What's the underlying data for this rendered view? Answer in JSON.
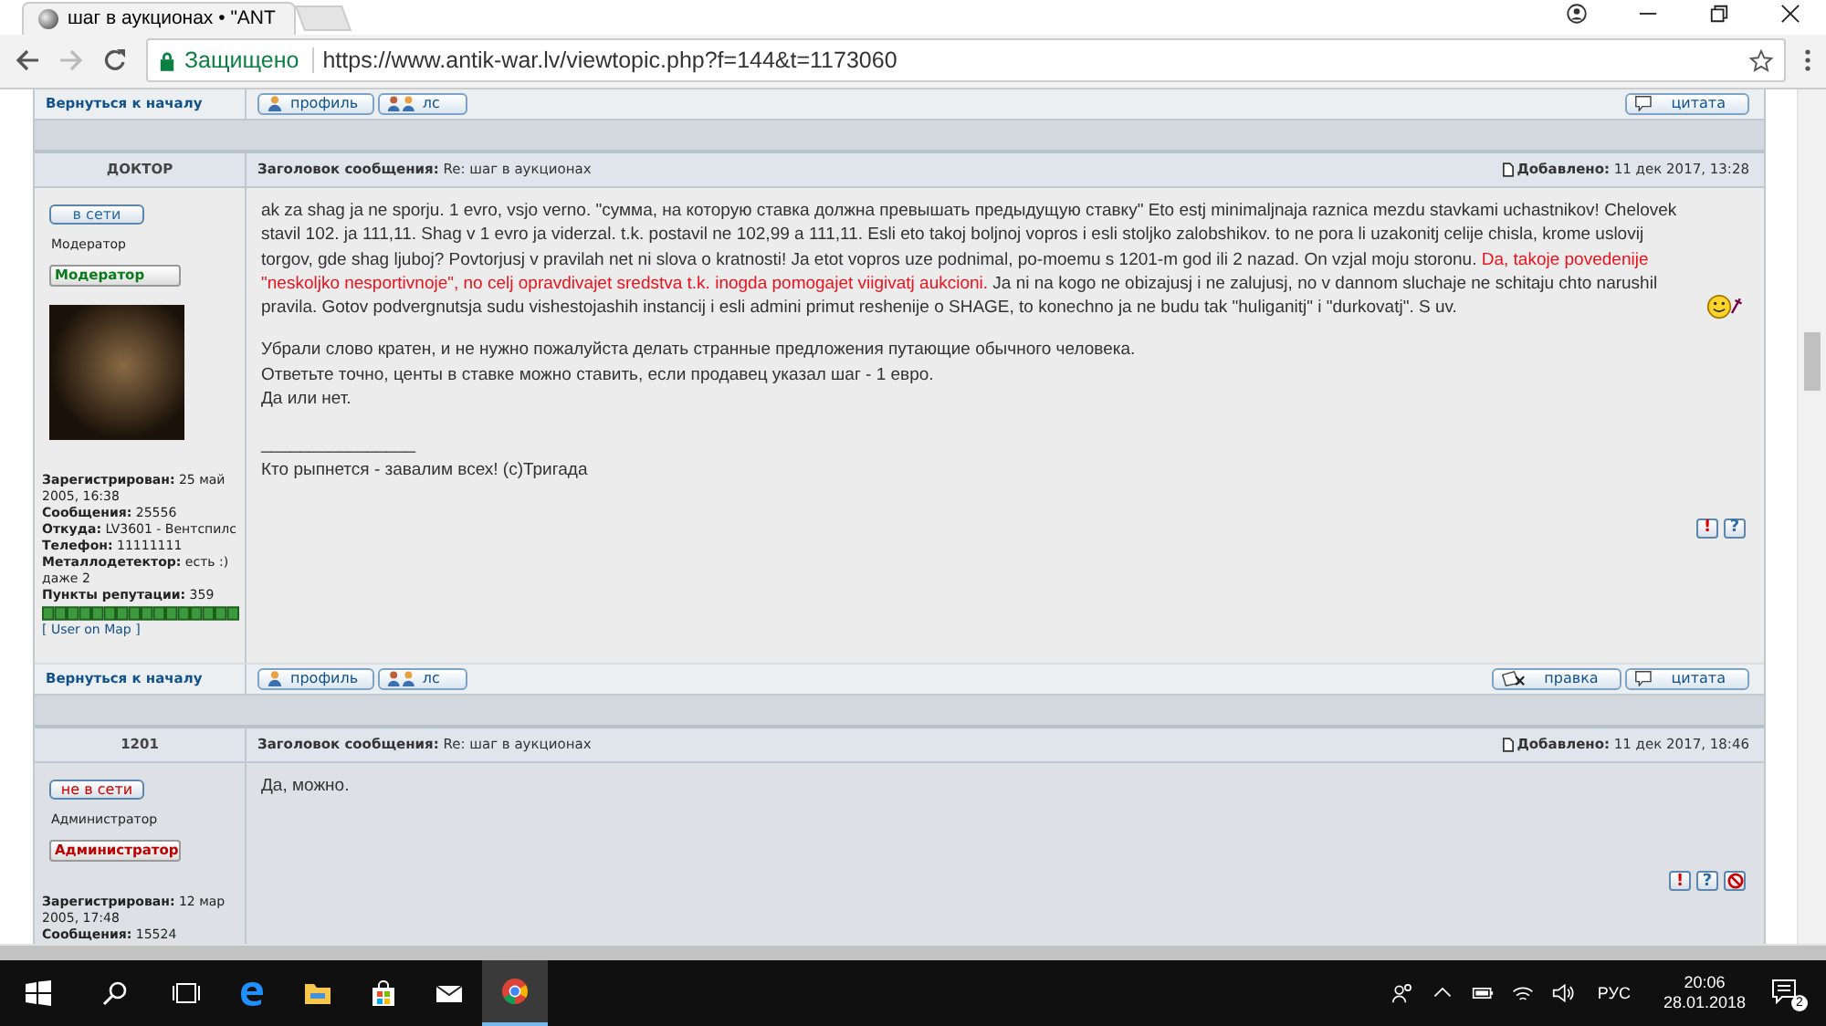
{
  "browser": {
    "tab_title": "шаг в аукционах • \"ANT",
    "secure_label": "Защищено",
    "url": "https://www.antik-war.lv/viewtopic.php?f=144&t=1173060"
  },
  "top_footer": {
    "back_link": "Вернуться к началу",
    "buttons": [
      {
        "kind": "profile",
        "label": "профиль"
      },
      {
        "kind": "pm",
        "label": "лс"
      }
    ],
    "right_buttons": [
      {
        "kind": "quote",
        "label": "цитата"
      }
    ]
  },
  "posts": [
    {
      "author": "ДОКТОР",
      "subject_label": "Заголовок сообщения:",
      "subject": "Re: шаг в аукционах",
      "added_label": "Добавлено:",
      "added": "11 дек 2017, 13:28",
      "online": true,
      "status_label": "в сети",
      "rank": "Модератор",
      "badge": {
        "kind": "moderator",
        "label": "Модератор"
      },
      "avatar": true,
      "details": [
        {
          "label": "Зарегистрирован:",
          "value": "25 май 2005, 16:38"
        },
        {
          "label": "Сообщения:",
          "value": "25556"
        },
        {
          "label": "Откуда:",
          "value": "LV3601 - Вентспилс"
        },
        {
          "label": "Телефон:",
          "value": "11111111"
        },
        {
          "label": "Металлодетектор:",
          "value": "есть :) даже 2"
        },
        {
          "label": "Пункты репутации:",
          "value": "359"
        }
      ],
      "reputation_bar": true,
      "map_link": "[ User on Map ]",
      "segments": [
        {
          "kind": "plain",
          "text": "ak za shag ja ne sporju. 1 evro, vsjo verno. \"сумма, на которую ставка должна превышать предыдущую ставку\" Eto estj minimaljnaja raznica mezdu stavkami uchastnikov! Chelovek stavil 102. ja 111,11. Shag v 1 evro ja viderzal. t.k. postavil ne 102,99 a 111,11. Esli eto takoj boljnoj vopros i esli stoljko zalobshikov. to ne pora li uzakonitj celije chisla, krome uslovij torgov, gde shag ljuboj? Povtorjusj v pravilah net ni slova o kratnosti! Ja etot vopros uze podnimal, po-moemu s 1201-m god ili 2 nazad. On vzjal moju storonu. "
        },
        {
          "kind": "highlight",
          "text": "Da, takoje povedenije \"neskoljko nesportivnoje\", no celj opravdivajet sredstva t.k. inogda pomogajet viigivatj aukcioni."
        },
        {
          "kind": "plain",
          "text": " Ja ni na kogo ne obizajusj i ne zalujusj, no v dannom sluchaje ne schitaju chto narushil pravila. Gotov podvergnutsja sudu vishestojashih instancij i esli admini primut reshenije o SHAGE, to konechno ja ne budu tak \"huliganitj\" i \"durkovatj\". S uv."
        }
      ],
      "smiley": true,
      "lines": [
        "Убрали слово кратен, и не нужно пожалуйста делать странные предложения путающие обычного человека.",
        "Ответьте точно, центы в ставке можно ставить, если продавец указал шаг - 1 евро.",
        "Да или нет."
      ],
      "signature_rule": "________________",
      "signature": "Кто рыпнется - завалим всех! (c)Тригада",
      "actions": [
        {
          "kind": "report",
          "label": "!"
        },
        {
          "kind": "info",
          "label": "?"
        }
      ],
      "footer": {
        "back_link": "Вернуться к началу",
        "buttons": [
          {
            "kind": "profile",
            "label": "профиль"
          },
          {
            "kind": "pm",
            "label": "лс"
          }
        ],
        "right_buttons": [
          {
            "kind": "edit",
            "label": "правка"
          },
          {
            "kind": "quote",
            "label": "цитата"
          }
        ]
      }
    },
    {
      "author": "1201",
      "subject_label": "Заголовок сообщения:",
      "subject": "Re: шаг в аукционах",
      "added_label": "Добавлено:",
      "added": "11 дек 2017, 18:46",
      "online": false,
      "status_label": "не в сети",
      "rank": "Администратор",
      "badge": {
        "kind": "admin",
        "label": "Администратор"
      },
      "avatar": false,
      "details": [
        {
          "label": "Зарегистрирован:",
          "value": "12 мар 2005, 17:48"
        },
        {
          "label": "Сообщения:",
          "value": "15524"
        }
      ],
      "reputation_bar": false,
      "segments": [
        {
          "kind": "plain",
          "text": "Да, можно."
        }
      ],
      "smiley": false,
      "actions": [
        {
          "kind": "report",
          "label": "!"
        },
        {
          "kind": "info",
          "label": "?"
        },
        {
          "kind": "ban"
        }
      ]
    }
  ],
  "taskbar": {
    "apps": [
      {
        "kind": "taskview",
        "active": false
      },
      {
        "kind": "edge",
        "active": false
      },
      {
        "kind": "folder",
        "active": false
      },
      {
        "kind": "store",
        "active": false
      },
      {
        "kind": "mail",
        "active": false
      },
      {
        "kind": "chrome",
        "active": true
      }
    ],
    "language": "РУС",
    "time": "20:06",
    "date": "28.01.2018",
    "notifications": "2"
  }
}
